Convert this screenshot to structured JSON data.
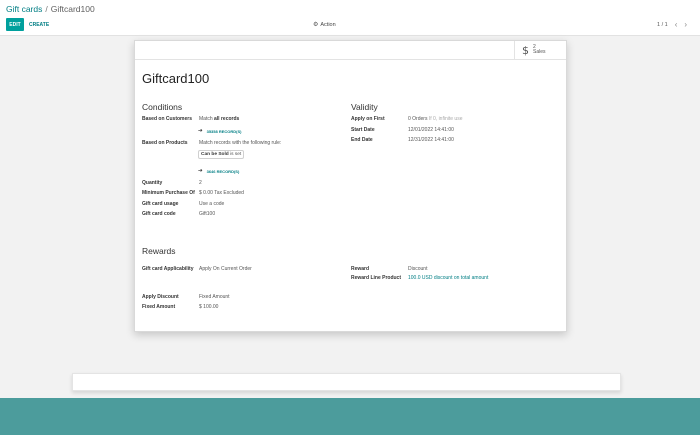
{
  "breadcrumb": {
    "parent": "Gift cards",
    "separator": "/",
    "current": "Giftcard100"
  },
  "toolbar": {
    "edit_label": "EDIT",
    "create_label": "CREATE",
    "action_label": "Action",
    "action_icon": "gear-icon"
  },
  "pager": {
    "value": "1 / 1",
    "prev_icon": "chevron-left-icon",
    "next_icon": "chevron-right-icon"
  },
  "smart_button": {
    "icon": "dollar-icon",
    "count": "2",
    "label": "Sales"
  },
  "record": {
    "name": "Giftcard100",
    "conditions": {
      "title": "Conditions",
      "based_on_customers": {
        "label": "Based on Customers",
        "prefix": "Match ",
        "value": "all records",
        "link": "35358 RECORD(S)"
      },
      "based_on_products": {
        "label": "Based on Products",
        "value": "Match records with the following rule:",
        "rule_field": "Can be Sold",
        "rule_op": "is set",
        "link": "3646 RECORD(S)"
      },
      "quantity": {
        "label": "Quantity",
        "value": "2"
      },
      "min_purchase": {
        "label": "Minimum Purchase Of",
        "value": "$ 0.00 Tax Excluded"
      },
      "usage": {
        "label": "Gift card usage",
        "value": "Use a code"
      },
      "code": {
        "label": "Gift card code",
        "value": "Gift100"
      }
    },
    "validity": {
      "title": "Validity",
      "apply_on_first": {
        "label": "Apply on First",
        "value": "0 Orders",
        "hint": "If 0, infinite use"
      },
      "start_date": {
        "label": "Start Date",
        "value": "12/01/2022 14:41:00"
      },
      "end_date": {
        "label": "End Date",
        "value": "12/31/2022 14:41:00"
      }
    },
    "rewards": {
      "title": "Rewards",
      "applicability": {
        "label": "Gift card Applicability",
        "value": "Apply On Current Order"
      },
      "reward": {
        "label": "Reward",
        "value": "Discount"
      },
      "reward_line_product": {
        "label": "Reward Line Product",
        "value": "100.0 USD discount on total amount"
      },
      "apply_discount": {
        "label": "Apply Discount",
        "value": "Fixed Amount"
      },
      "fixed_amount": {
        "label": "Fixed Amount",
        "value": "$ 100.00"
      }
    }
  },
  "colors": {
    "accent": "#017e84",
    "primary_button": "#00a09d",
    "footer_band": "#4c9c9c"
  }
}
